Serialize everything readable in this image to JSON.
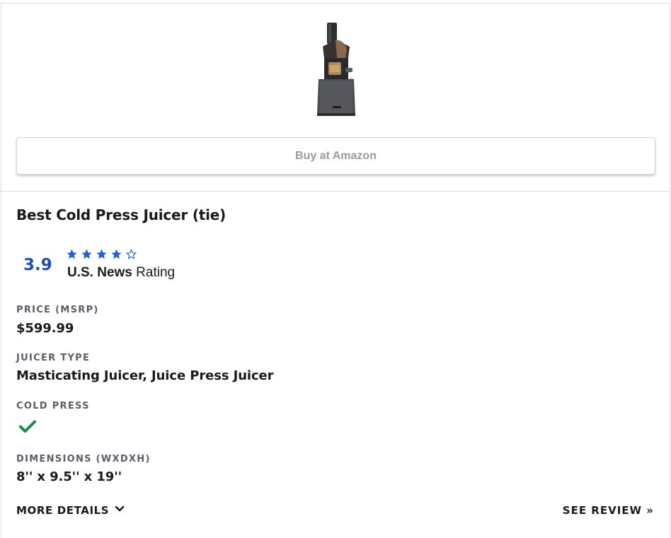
{
  "buy_button": {
    "label": "Buy at Amazon"
  },
  "product": {
    "title": "Best Cold Press Juicer (tie)"
  },
  "rating": {
    "score": "3.9",
    "stars_filled": 4,
    "stars_total": 5,
    "brand": "U.S. News",
    "label": "Rating"
  },
  "specs": {
    "price_label": "PRICE (MSRP)",
    "price_value": "$599.99",
    "type_label": "JUICER TYPE",
    "type_value": "Masticating Juicer, Juice Press Juicer",
    "cold_press_label": "COLD PRESS",
    "cold_press_value": true,
    "dimensions_label": "DIMENSIONS (WXDXH)",
    "dimensions_value": "8'' x 9.5'' x 19''"
  },
  "links": {
    "more_details": "MORE DETAILS",
    "see_review": "SEE REVIEW »"
  },
  "icons": {
    "star": "star-icon",
    "check": "check-icon",
    "chevron": "chevron-down-icon"
  },
  "colors": {
    "accent_blue": "#1b4fb5",
    "star_blue": "#1e63d6",
    "check_green": "#1a8a4a",
    "border": "#dcdcdc",
    "label_gray": "#5c5c6b"
  }
}
